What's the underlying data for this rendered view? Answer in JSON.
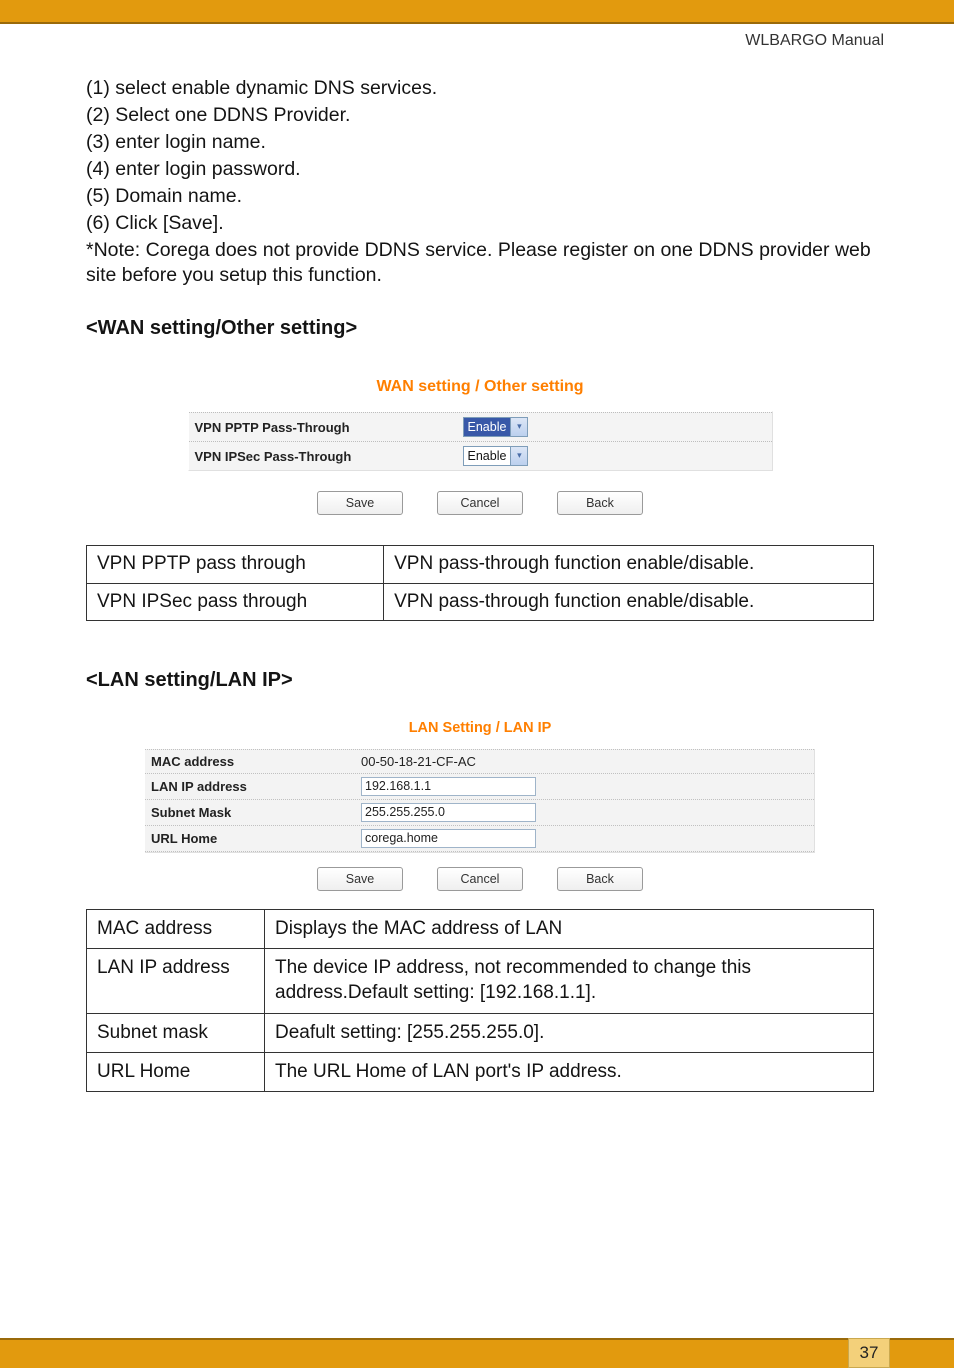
{
  "header": {
    "title": "WLBARGO Manual"
  },
  "steps": {
    "s1": "(1) select enable dynamic DNS services.",
    "s2": "(2) Select one DDNS Provider.",
    "s3": "(3) enter login name.",
    "s4": "(4) enter login password.",
    "s5": "(5) Domain name.",
    "s6": "(6) Click [Save].",
    "note": "*Note: Corega does not provide DDNS service.  Please register on one DDNS provider web site before you setup this function."
  },
  "wan": {
    "heading": "<WAN setting/Other setting>",
    "fig_title": "WAN setting / Other setting",
    "row1_label": "VPN PPTP Pass-Through",
    "row2_label": "VPN IPSec Pass-Through",
    "enable": "Enable",
    "buttons": {
      "save": "Save",
      "cancel": "Cancel",
      "back": "Back"
    },
    "desc": {
      "r1c1": "VPN PPTP pass through",
      "r1c2": "VPN pass-through function enable/disable.",
      "r2c1": "VPN IPSec pass through",
      "r2c2": "VPN pass-through function enable/disable."
    }
  },
  "lan": {
    "heading": "<LAN setting/LAN IP>",
    "fig_title": "LAN Setting / LAN IP",
    "rows": {
      "mac_label": "MAC address",
      "mac_value": "00-50-18-21-CF-AC",
      "ip_label": "LAN IP address",
      "ip_value": "192.168.1.1",
      "mask_label": "Subnet Mask",
      "mask_value": "255.255.255.0",
      "url_label": "URL Home",
      "url_value": "corega.home"
    },
    "buttons": {
      "save": "Save",
      "cancel": "Cancel",
      "back": "Back"
    },
    "desc": {
      "r1c1": "MAC address",
      "r1c2": "Displays the MAC address of LAN",
      "r2c1": "LAN IP address",
      "r2c2": "The device IP address, not recommended to change this address.Default setting: [192.168.1.1].",
      "r3c1": "Subnet mask",
      "r3c2": "Deafult setting: [255.255.255.0].",
      "r4c1": "URL Home",
      "r4c2": "The URL Home of LAN port's IP address."
    }
  },
  "page_number": "37"
}
